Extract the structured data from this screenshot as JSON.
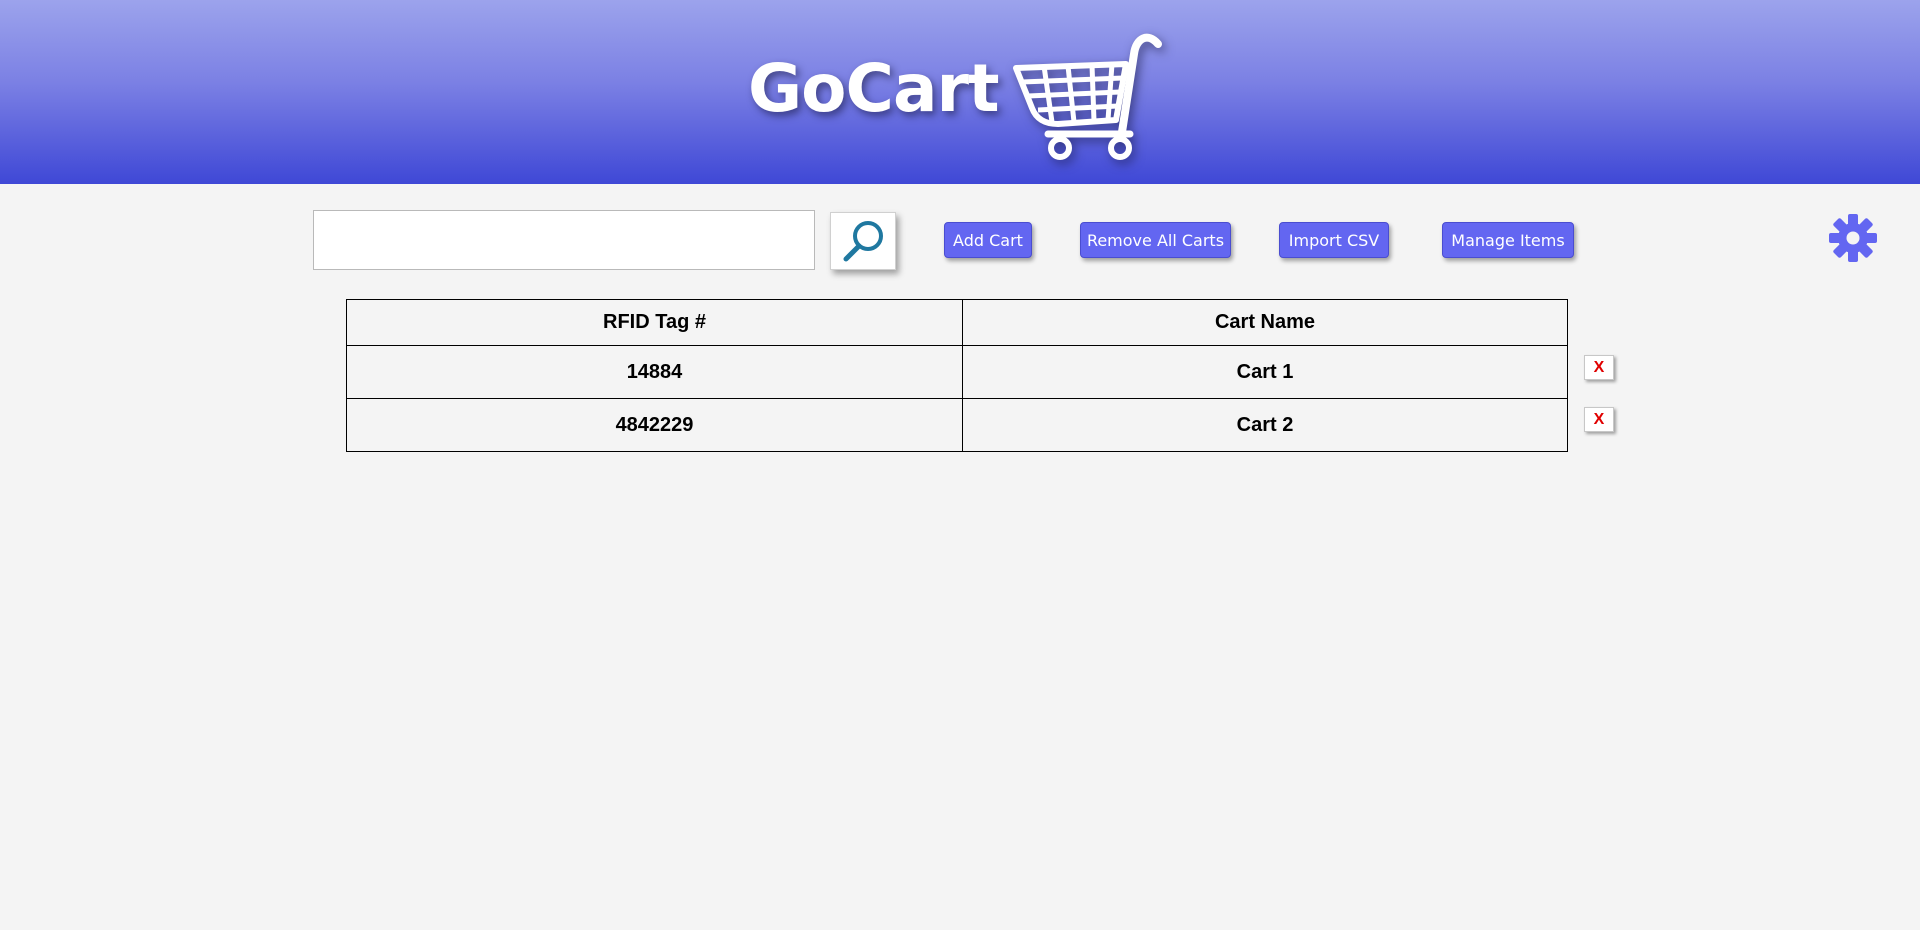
{
  "app": {
    "title": "GoCart",
    "logo_icon": "shopping-cart-icon"
  },
  "toolbar": {
    "search_value": "",
    "search_icon": "magnifier-icon",
    "add_cart_label": "Add Cart",
    "remove_all_label": "Remove All Carts",
    "import_csv_label": "Import CSV",
    "manage_items_label": "Manage Items",
    "settings_icon": "gear-icon"
  },
  "table": {
    "headers": [
      "RFID Tag #",
      "Cart Name"
    ],
    "rows": [
      {
        "rfid": "14884",
        "cart_name": "Cart 1",
        "delete_label": "X"
      },
      {
        "rfid": "4842229",
        "cart_name": "Cart 2",
        "delete_label": "X"
      }
    ]
  },
  "colors": {
    "accent": "#6366f1",
    "header_top": "#9ca3ec",
    "header_bottom": "#3f48d6",
    "delete_x": "#e00000",
    "search_icon": "#1f78a0"
  }
}
